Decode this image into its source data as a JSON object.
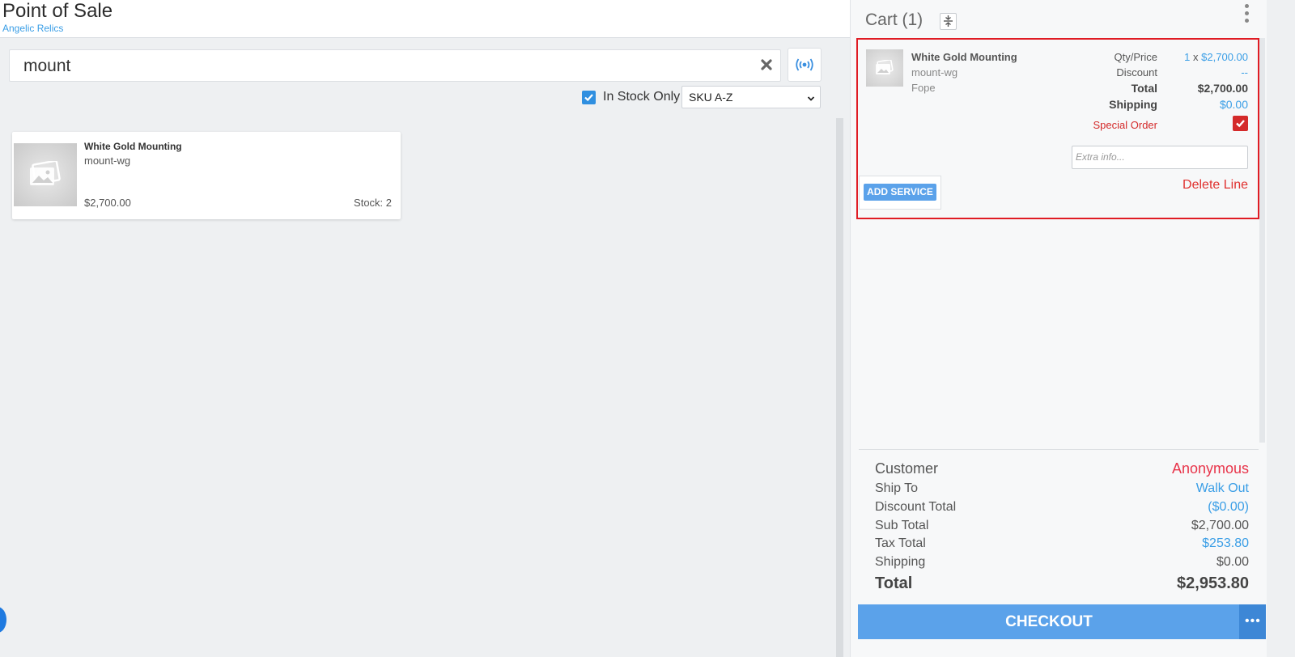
{
  "header": {
    "title": "Point of Sale",
    "subtitle": "Angelic Relics"
  },
  "search": {
    "value": "mount",
    "clear_icon": "close-icon",
    "scan_icon": "broadcast-icon"
  },
  "filters": {
    "in_stock_label": "In Stock Only",
    "in_stock_checked": true,
    "sort_value": "SKU A-Z"
  },
  "products": [
    {
      "name": "White Gold Mounting",
      "sku": "mount-wg",
      "price": "$2,700.00",
      "stock": "Stock: 2"
    }
  ],
  "cart": {
    "title": "Cart (1)",
    "line": {
      "name": "White Gold Mounting",
      "sku": "mount-wg",
      "brand": "Fope",
      "qty_price_label": "Qty/Price",
      "qty": "1",
      "qty_sep": "x",
      "price": "$2,700.00",
      "discount_label": "Discount",
      "discount_value": "--",
      "total_label": "Total",
      "total_value": "$2,700.00",
      "shipping_label": "Shipping",
      "shipping_value": "$0.00",
      "special_order_label": "Special Order",
      "special_order_checked": true,
      "extra_info_placeholder": "Extra info...",
      "delete_label": "Delete Line",
      "add_service_label": "ADD SERVICE"
    },
    "summary": {
      "customer_label": "Customer",
      "customer_value": "Anonymous",
      "ship_to_label": "Ship To",
      "ship_to_value": "Walk Out",
      "discount_total_label": "Discount Total",
      "discount_total_value": "($0.00)",
      "sub_total_label": "Sub Total",
      "sub_total_value": "$2,700.00",
      "tax_total_label": "Tax Total",
      "tax_total_value": "$253.80",
      "shipping_label": "Shipping",
      "shipping_value": "$0.00",
      "total_label": "Total",
      "total_value": "$2,953.80"
    },
    "checkout_label": "CHECKOUT",
    "checkout_more": "•••"
  },
  "colors": {
    "accent": "#5ba2ea",
    "link": "#3a9ee6",
    "danger": "#e0312f"
  }
}
